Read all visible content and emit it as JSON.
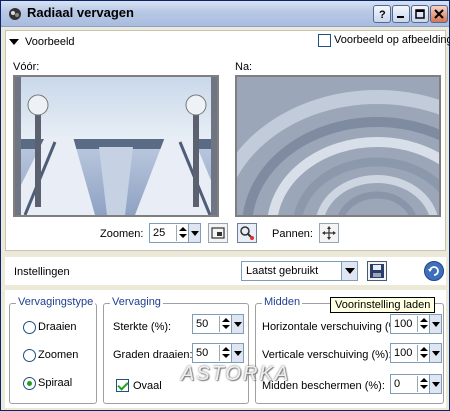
{
  "window": {
    "title": "Radiaal vervagen",
    "buttons": [
      "help-icon",
      "minimize-icon",
      "maximize-icon",
      "close-icon"
    ]
  },
  "preview": {
    "section_label": "Voorbeeld",
    "preview_on_image_label": "Voorbeeld op afbeelding",
    "preview_on_image_checked": false,
    "before_label": "Vóór:",
    "after_label": "Na:",
    "zoom_label": "Zoomen:",
    "zoom_value": "25",
    "pan_label": "Pannen:"
  },
  "settings": {
    "label": "Instellingen",
    "preset_value": "Laatst gebruikt",
    "tooltip": "Voorinstelling laden"
  },
  "distortion_type": {
    "title": "Vervagingstype",
    "options": [
      "Draaien",
      "Zoomen",
      "Spiraal"
    ],
    "selected": "Spiraal"
  },
  "distortion": {
    "title": "Vervaging",
    "strength_label": "Sterkte (%):",
    "strength_value": "50",
    "twist_label": "Graden draaien:",
    "twist_value": "50",
    "oval_label": "Ovaal",
    "oval_checked": true
  },
  "center": {
    "title": "Midden",
    "horizontal_label": "Horizontale verschuiving (%):",
    "horizontal_value": "100",
    "vertical_label": "Verticale verschuiving (%):",
    "vertical_value": "100",
    "protect_label": "Midden beschermen (%):",
    "protect_value": "0"
  },
  "watermark": "ASTORKA",
  "colors": {
    "title_gradient_start": "#d8e2f3",
    "accent_check": "#21a121",
    "group_label": "#1f3f8f"
  }
}
